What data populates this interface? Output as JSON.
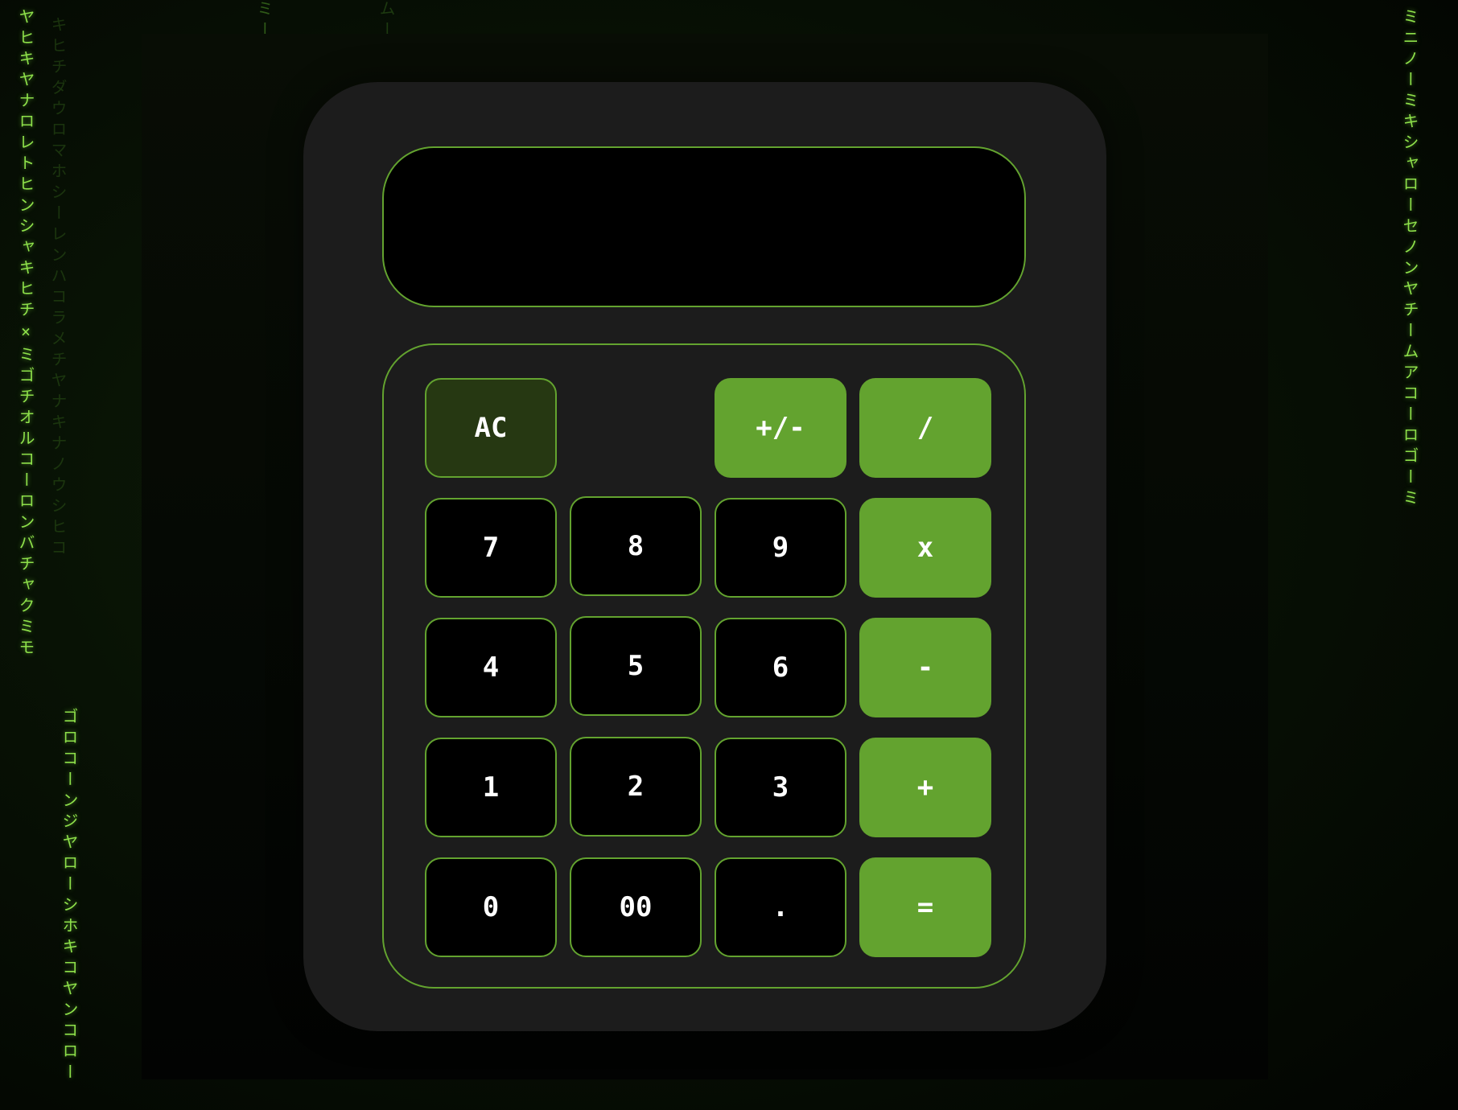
{
  "display": {
    "value": ""
  },
  "keys": {
    "ac": "AC",
    "sign": "+/-",
    "divide": "/",
    "seven": "7",
    "eight": "8",
    "nine": "9",
    "multiply": "x",
    "four": "4",
    "five": "5",
    "six": "6",
    "subtract": "-",
    "one": "1",
    "two": "2",
    "three": "3",
    "add": "+",
    "zero": "0",
    "double_zero": "00",
    "decimal": ".",
    "equals": "="
  },
  "theme": {
    "accent": "#63a32f",
    "body": "#1c1c1c",
    "ac_background": "#263812",
    "display_background": "#000000"
  },
  "background_rain": {
    "col1": "ヤヒキヤナロレトヒンシャキヒチ×ミゴチオルコーロンバチャクミモ",
    "col2": "キヒチダウロマホシーレンハコラメチヤナキナノウシヒコ",
    "col3": "ミーコーナモ",
    "col4": "ムートンイクニミヤヒ",
    "col5": "ゴロコーンジヤローシホキコヤンコロー",
    "col6": "ミニノーミキシャローセノンヤチームアコーロゴーミ"
  }
}
